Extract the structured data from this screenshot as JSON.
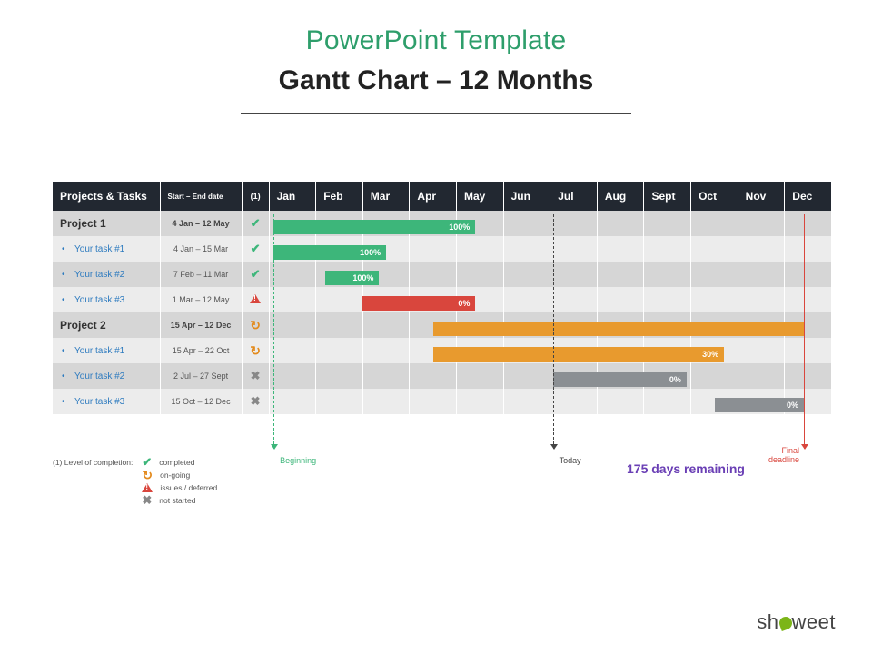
{
  "header": {
    "supertitle": "PowerPoint Template",
    "title": "Gantt Chart – 12 Months"
  },
  "columns": {
    "projects": "Projects & Tasks",
    "dates": "Start – End date",
    "status": "(1)"
  },
  "months": [
    "Jan",
    "Feb",
    "Mar",
    "Apr",
    "May",
    "Jun",
    "Jul",
    "Aug",
    "Sept",
    "Oct",
    "Nov",
    "Dec"
  ],
  "rows": [
    {
      "kind": "project",
      "name": "Project 1",
      "dates": "4 Jan – 12 May",
      "status": "completed"
    },
    {
      "kind": "task",
      "name": "Your task #1",
      "dates": "4 Jan – 15 Mar",
      "status": "completed"
    },
    {
      "kind": "task",
      "name": "Your task #2",
      "dates": "7 Feb – 11 Mar",
      "status": "completed"
    },
    {
      "kind": "task",
      "name": "Your task #3",
      "dates": "1 Mar – 12 May",
      "status": "issues"
    },
    {
      "kind": "project",
      "name": "Project 2",
      "dates": "15 Apr – 12 Dec",
      "status": "ongoing"
    },
    {
      "kind": "task",
      "name": "Your task #1",
      "dates": "15 Apr – 22 Oct",
      "status": "ongoing"
    },
    {
      "kind": "task",
      "name": "Your task #2",
      "dates": "2 Jul – 27 Sept",
      "status": "notstarted"
    },
    {
      "kind": "task",
      "name": "Your task #3",
      "dates": "15 Oct – 12 Dec",
      "status": "notstarted"
    }
  ],
  "legend": {
    "title": "(1) Level of completion:",
    "items": {
      "completed": "completed",
      "ongoing": "on-going",
      "issues": "issues / deferred",
      "notstarted": "not started"
    }
  },
  "markers": {
    "beginning": "Beginning",
    "today": "Today",
    "final": "Final\ndeadline"
  },
  "remaining": "175 days remaining",
  "brand": {
    "pre": "sh",
    "post": "weet"
  },
  "chart_data": {
    "type": "gantt",
    "time_axis": {
      "unit": "month",
      "labels": [
        "Jan",
        "Feb",
        "Mar",
        "Apr",
        "May",
        "Jun",
        "Jul",
        "Aug",
        "Sept",
        "Oct",
        "Nov",
        "Dec"
      ]
    },
    "bars": [
      {
        "row": 0,
        "name": "Project 1",
        "start_month": 0.1,
        "end_month": 4.4,
        "color": "green",
        "label": "100%"
      },
      {
        "row": 1,
        "name": "Your task #1",
        "start_month": 0.1,
        "end_month": 2.5,
        "color": "green",
        "label": "100%"
      },
      {
        "row": 2,
        "name": "Your task #2",
        "start_month": 1.2,
        "end_month": 2.35,
        "color": "green",
        "label": "100%"
      },
      {
        "row": 3,
        "name": "Your task #3",
        "start_month": 2.0,
        "end_month": 4.4,
        "color": "red",
        "label": "0%"
      },
      {
        "row": 4,
        "name": "Project 2",
        "start_month": 3.5,
        "end_month": 11.4,
        "color": "orange",
        "label": ""
      },
      {
        "row": 5,
        "name": "Your task #1",
        "start_month": 3.5,
        "end_month": 9.7,
        "color": "orange",
        "label": "30%"
      },
      {
        "row": 6,
        "name": "Your task #2",
        "start_month": 6.05,
        "end_month": 8.9,
        "color": "grey",
        "label": "0%"
      },
      {
        "row": 7,
        "name": "Your task #3",
        "start_month": 9.5,
        "end_month": 11.4,
        "color": "grey",
        "label": "0%"
      }
    ],
    "markers": [
      {
        "name": "beginning",
        "month": 0.1,
        "color": "green"
      },
      {
        "name": "today",
        "month": 6.05,
        "color": "black"
      },
      {
        "name": "final",
        "month": 11.4,
        "color": "red"
      }
    ],
    "remaining_days": 175
  }
}
